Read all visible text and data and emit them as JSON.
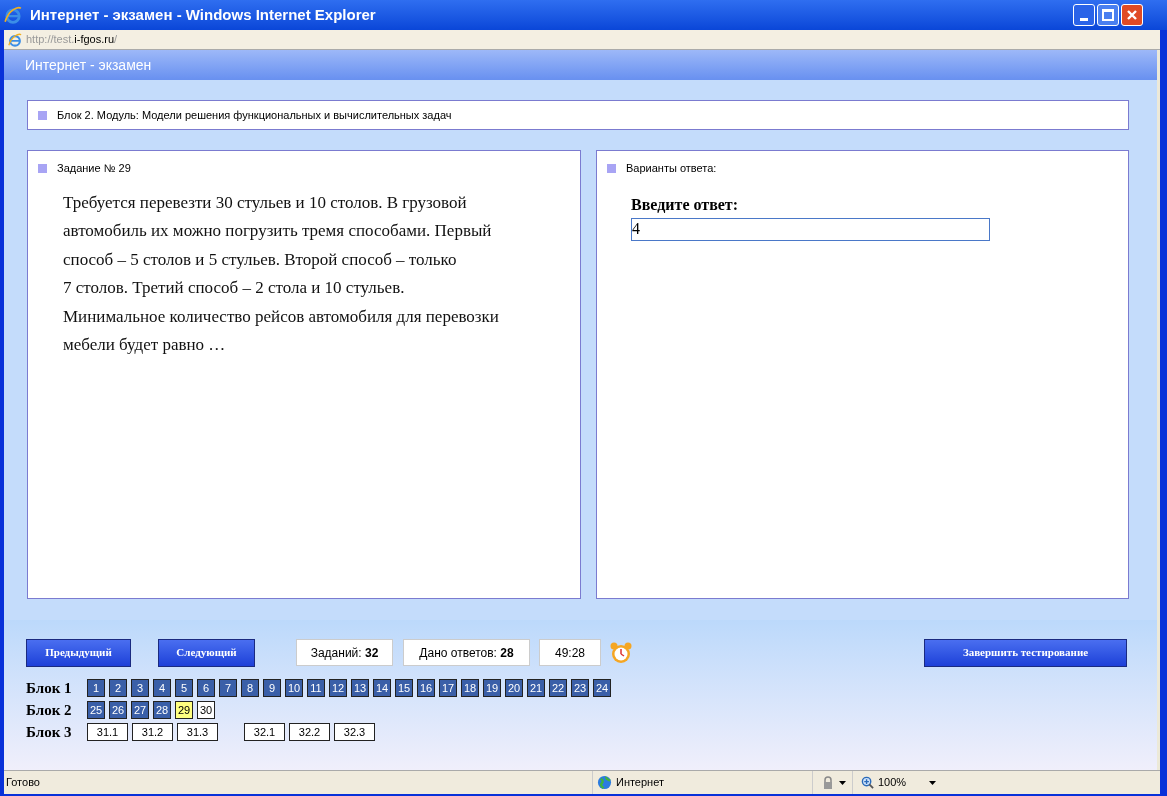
{
  "window": {
    "title": "Интернет - экзамен - Windows Internet Explorer"
  },
  "address": {
    "prefix": "http://test.",
    "domain": "i-fgos.ru",
    "suffix": "/"
  },
  "page_title": "Интернет - экзамен",
  "block_header": "Блок 2. Модуль: Модели решения функциональных и вычислительных задач",
  "task_panel": {
    "heading": "Задание № 29",
    "text": "Требуется перевезти 30 стульев и 10 столов. В грузовой\nавтомобиль их можно погрузить тремя способами. Первый\nспособ – 5 столов и 5 стульев. Второй способ – только\n7 столов. Третий способ – 2 стола и 10 стульев.\nМинимальное количество рейсов автомобиля для перевозки\nмебели будет равно …"
  },
  "answer_panel": {
    "heading": "Варианты ответа:",
    "prompt": "Введите ответ:",
    "value": "4"
  },
  "nav": {
    "prev": "Предыдущий",
    "next": "Следующий",
    "finish": "Завершить тестирование"
  },
  "counters": [
    {
      "label": "Заданий: ",
      "value": "32"
    },
    {
      "label": "Дано ответов: ",
      "value": "28"
    }
  ],
  "timer": "49:28",
  "blocks": [
    {
      "label": "Блок 1",
      "items": [
        {
          "n": "1",
          "answered": true,
          "selected": false
        },
        {
          "n": "2",
          "answered": true,
          "selected": false
        },
        {
          "n": "3",
          "answered": true,
          "selected": false
        },
        {
          "n": "4",
          "answered": true,
          "selected": false
        },
        {
          "n": "5",
          "answered": true,
          "selected": false
        },
        {
          "n": "6",
          "answered": true,
          "selected": false
        },
        {
          "n": "7",
          "answered": true,
          "selected": false
        },
        {
          "n": "8",
          "answered": true,
          "selected": false
        },
        {
          "n": "9",
          "answered": true,
          "selected": false
        },
        {
          "n": "10",
          "answered": true,
          "selected": false
        },
        {
          "n": "11",
          "answered": true,
          "selected": false
        },
        {
          "n": "12",
          "answered": true,
          "selected": false
        },
        {
          "n": "13",
          "answered": true,
          "selected": false
        },
        {
          "n": "14",
          "answered": true,
          "selected": false
        },
        {
          "n": "15",
          "answered": true,
          "selected": false
        },
        {
          "n": "16",
          "answered": true,
          "selected": false
        },
        {
          "n": "17",
          "answered": true,
          "selected": false
        },
        {
          "n": "18",
          "answered": true,
          "selected": false
        },
        {
          "n": "19",
          "answered": true,
          "selected": false
        },
        {
          "n": "20",
          "answered": true,
          "selected": false
        },
        {
          "n": "21",
          "answered": true,
          "selected": false
        },
        {
          "n": "22",
          "answered": true,
          "selected": false
        },
        {
          "n": "23",
          "answered": true,
          "selected": false
        },
        {
          "n": "24",
          "answered": true,
          "selected": false
        }
      ]
    },
    {
      "label": "Блок 2",
      "items": [
        {
          "n": "25",
          "answered": true,
          "selected": false
        },
        {
          "n": "26",
          "answered": true,
          "selected": false
        },
        {
          "n": "27",
          "answered": true,
          "selected": false
        },
        {
          "n": "28",
          "answered": true,
          "selected": false
        },
        {
          "n": "29",
          "answered": false,
          "selected": true
        },
        {
          "n": "30",
          "answered": false,
          "selected": false
        }
      ]
    },
    {
      "label": "Блок 3",
      "items": [
        {
          "n": "31.1",
          "answered": false,
          "selected": false
        },
        {
          "n": "31.2",
          "answered": false,
          "selected": false
        },
        {
          "n": "31.3",
          "answered": false,
          "selected": false
        },
        {
          "n": "32.1",
          "answered": false,
          "selected": false,
          "gap": true
        },
        {
          "n": "32.2",
          "answered": false,
          "selected": false
        },
        {
          "n": "32.3",
          "answered": false,
          "selected": false
        }
      ]
    }
  ],
  "status_bar": {
    "status": "Готово",
    "zone": "Интернет",
    "zoom": "100%"
  }
}
